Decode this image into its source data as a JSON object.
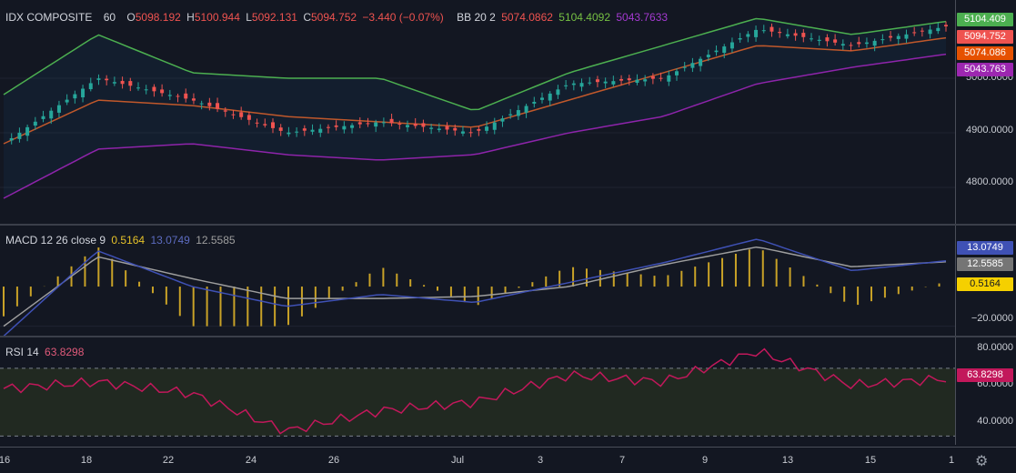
{
  "main": {
    "symbol": "IDX COMPOSITE",
    "interval": "60",
    "o_label": "O",
    "o": "5098.192",
    "h_label": "H",
    "h": "5100.944",
    "l_label": "L",
    "l": "5092.131",
    "c_label": "C",
    "c": "5094.752",
    "change": "−3.440 (−0.07%)",
    "bb_label": "BB 20 2",
    "bb_basis": "5074.0862",
    "bb_upper": "5104.4092",
    "bb_lower": "5043.7633",
    "ticks": [
      "4900.0000",
      "4800.0000",
      "5000.0000"
    ],
    "tags": {
      "upper": "5104.409",
      "close": "5094.752",
      "basis": "5074.086",
      "lower": "5043.763"
    }
  },
  "macd": {
    "label": "MACD 12 26 close 9",
    "hist": "0.5164",
    "macd": "13.0749",
    "signal": "12.5585",
    "ticks": [
      "−20.0000"
    ],
    "tags": {
      "macd": "13.0749",
      "signal": "12.5585",
      "hist": "0.5164"
    }
  },
  "rsi": {
    "label": "RSI 14",
    "value": "63.8298",
    "ticks": [
      "80.0000",
      "60.0000",
      "40.0000"
    ],
    "tag": "63.8298"
  },
  "xaxis": [
    "16",
    "18",
    "22",
    "24",
    "26",
    "Jul",
    "3",
    "7",
    "9",
    "13",
    "15",
    "1"
  ],
  "icons": {
    "settings": "gear-icon"
  },
  "colors": {
    "background": "#131722",
    "up": "#26a69a",
    "down": "#ef5350",
    "bb_upper": "#4caf50",
    "bb_basis": "#c0582b",
    "bb_lower": "#8e24aa",
    "macd_line": "#3f51b5",
    "signal_line": "#9e9e9e",
    "histogram": "#c9a227",
    "rsi_line": "#c2185b"
  },
  "chart_data": [
    {
      "type": "line",
      "title": "IDX COMPOSITE 60",
      "x": [
        "16",
        "18",
        "22",
        "24",
        "26",
        "Jul",
        "3",
        "7",
        "9",
        "13",
        "15"
      ],
      "series": [
        {
          "name": "BB upper",
          "values": [
            4970,
            5080,
            5010,
            5000,
            5000,
            4940,
            5010,
            5060,
            5110,
            5080,
            5104
          ]
        },
        {
          "name": "BB basis",
          "values": [
            4880,
            4960,
            4950,
            4930,
            4920,
            4910,
            4960,
            5010,
            5060,
            5050,
            5074
          ]
        },
        {
          "name": "BB lower",
          "values": [
            4780,
            4870,
            4880,
            4860,
            4850,
            4860,
            4900,
            4930,
            4990,
            5020,
            5044
          ]
        },
        {
          "name": "Close",
          "values": [
            4880,
            5000,
            4960,
            4900,
            4920,
            4900,
            4990,
            5000,
            5090,
            5060,
            5095
          ]
        }
      ],
      "ylim": [
        4740,
        5130
      ]
    },
    {
      "type": "line",
      "title": "MACD 12 26 close 9",
      "x": [
        "16",
        "18",
        "22",
        "24",
        "26",
        "Jul",
        "3",
        "7",
        "9",
        "13",
        "15"
      ],
      "series": [
        {
          "name": "MACD",
          "values": [
            -25,
            18,
            0,
            -10,
            -4,
            -8,
            2,
            12,
            24,
            8,
            13
          ]
        },
        {
          "name": "Signal",
          "values": [
            -20,
            15,
            4,
            -6,
            -6,
            -5,
            0,
            11,
            20,
            10,
            12.5
          ]
        },
        {
          "name": "Histogram",
          "values": [
            -3,
            4,
            -4,
            -4,
            2,
            -2,
            2,
            1,
            4,
            -2,
            0.5
          ]
        }
      ],
      "ylim": [
        -22,
        28
      ]
    },
    {
      "type": "line",
      "title": "RSI 14",
      "x": [
        "16",
        "18",
        "22",
        "24",
        "26",
        "Jul",
        "3",
        "7",
        "9",
        "13",
        "15"
      ],
      "series": [
        {
          "name": "RSI",
          "values": [
            58,
            62,
            55,
            33,
            45,
            50,
            66,
            62,
            80,
            60,
            63.8
          ]
        }
      ],
      "bands": [
        70,
        30
      ],
      "ylim": [
        27,
        86
      ]
    }
  ]
}
